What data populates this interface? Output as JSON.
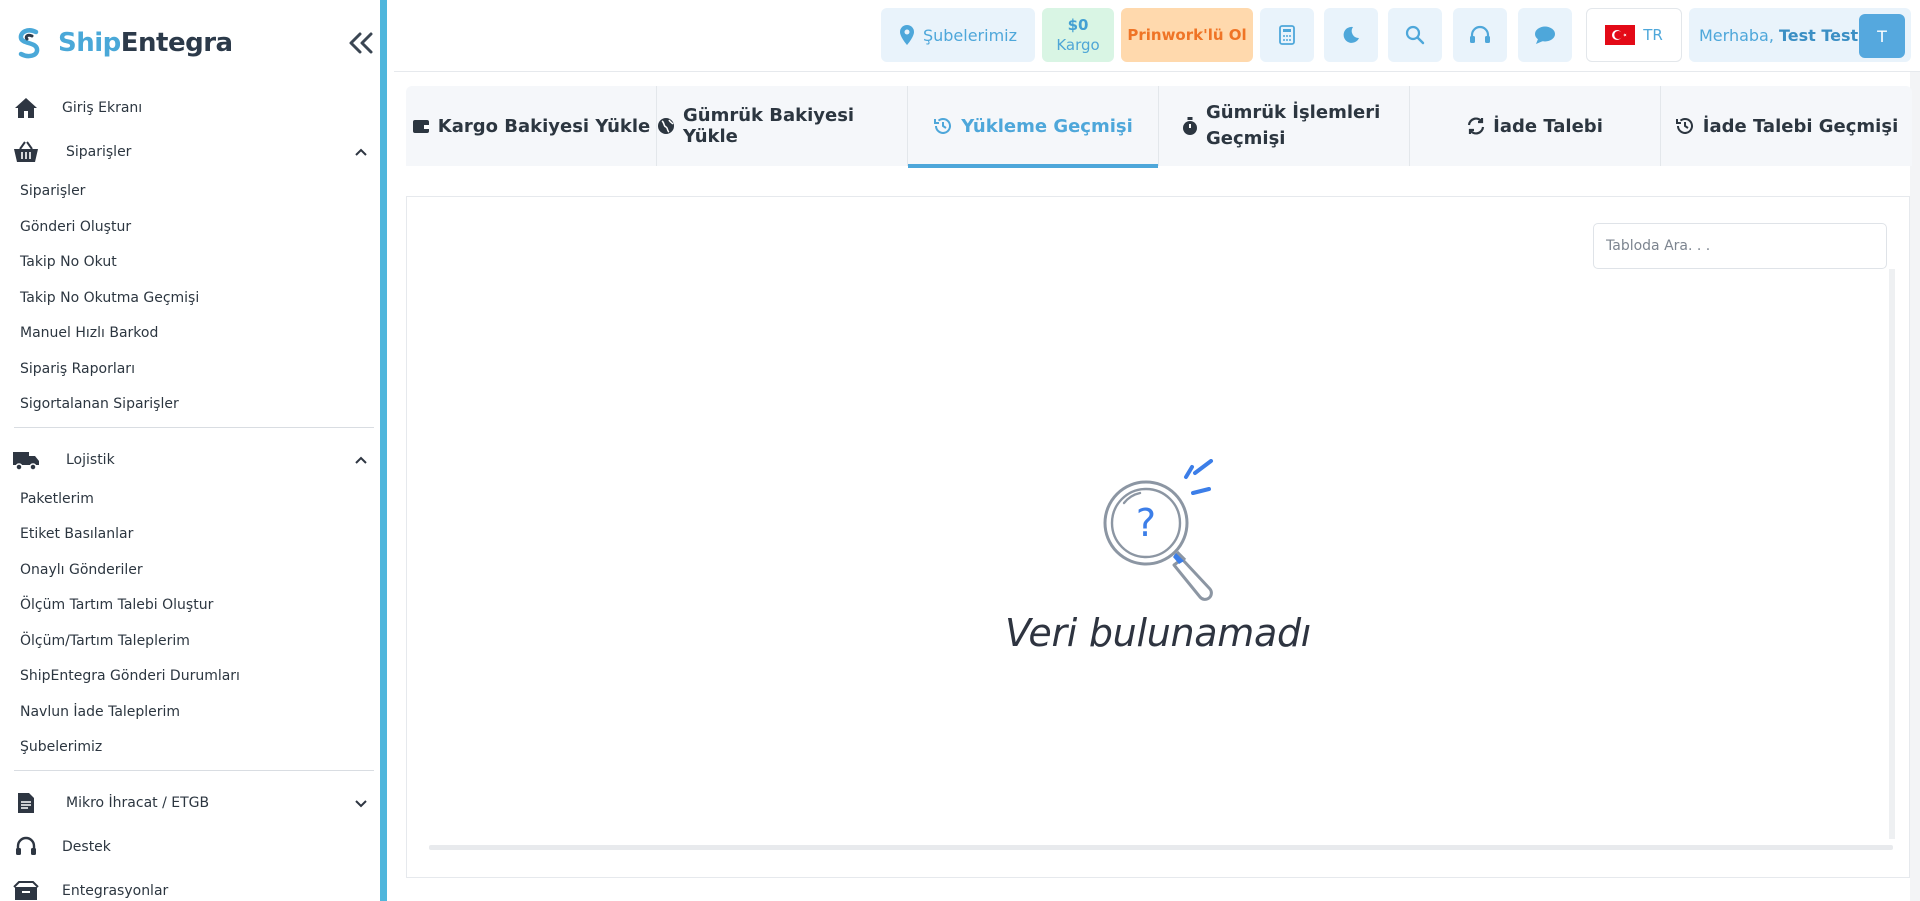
{
  "brand": {
    "part1": "Ship",
    "part2": "Entegra"
  },
  "sidebar": {
    "home_label": "Giriş Ekranı",
    "orders": {
      "label": "Siparişler",
      "items": [
        "Siparişler",
        "Gönderi Oluştur",
        "Takip No Okut",
        "Takip No Okutma Geçmişi",
        "Manuel Hızlı Barkod",
        "Sipariş Raporları",
        "Sigortalanan Siparişler"
      ]
    },
    "logistics": {
      "label": "Lojistik",
      "items": [
        "Paketlerim",
        "Etiket Basılanlar",
        "Onaylı Gönderiler",
        "Ölçüm Tartım Talebi Oluştur",
        "Ölçüm/Tartım Taleplerim",
        "ShipEntegra Gönderi Durumları",
        "Navlun İade Taleplerim",
        "Şubelerimiz"
      ]
    },
    "export_label": "Mikro İhracat / ETGB",
    "support_label": "Destek",
    "integrations_label": "Entegrasyonlar"
  },
  "topbar": {
    "branches_label": "Şubelerimiz",
    "balance_amount": "$0",
    "balance_unit": "Kargo",
    "promo_label": "Prinwork'lü Ol",
    "language": "TR",
    "greeting": "Merhaba,",
    "user_name": "Test Test",
    "avatar_initial": "T"
  },
  "tabs": [
    {
      "label": "Kargo Bakiyesi Yükle",
      "icon": "wallet-icon",
      "active": false
    },
    {
      "label": "Gümrük Bakiyesi Yükle",
      "icon": "globe-icon",
      "active": false
    },
    {
      "label": "Yükleme Geçmişi",
      "icon": "history-icon",
      "active": true
    },
    {
      "label": "Gümrük İşlemleri Geçmişi",
      "icon": "stopwatch-icon",
      "active": false
    },
    {
      "label": "İade Talebi",
      "icon": "refresh-icon",
      "active": false
    },
    {
      "label": "İade Talebi Geçmişi",
      "icon": "history-icon",
      "active": false
    }
  ],
  "table": {
    "search_placeholder": "Tabloda Ara. . .",
    "empty_message": "Veri bulunamadı"
  },
  "colors": {
    "accent": "#4ea7da",
    "sidebar_border": "#4fb6dc",
    "promo_bg": "#ffd9ad",
    "promo_text": "#ef7426",
    "balance_bg": "#d9f5e4"
  }
}
